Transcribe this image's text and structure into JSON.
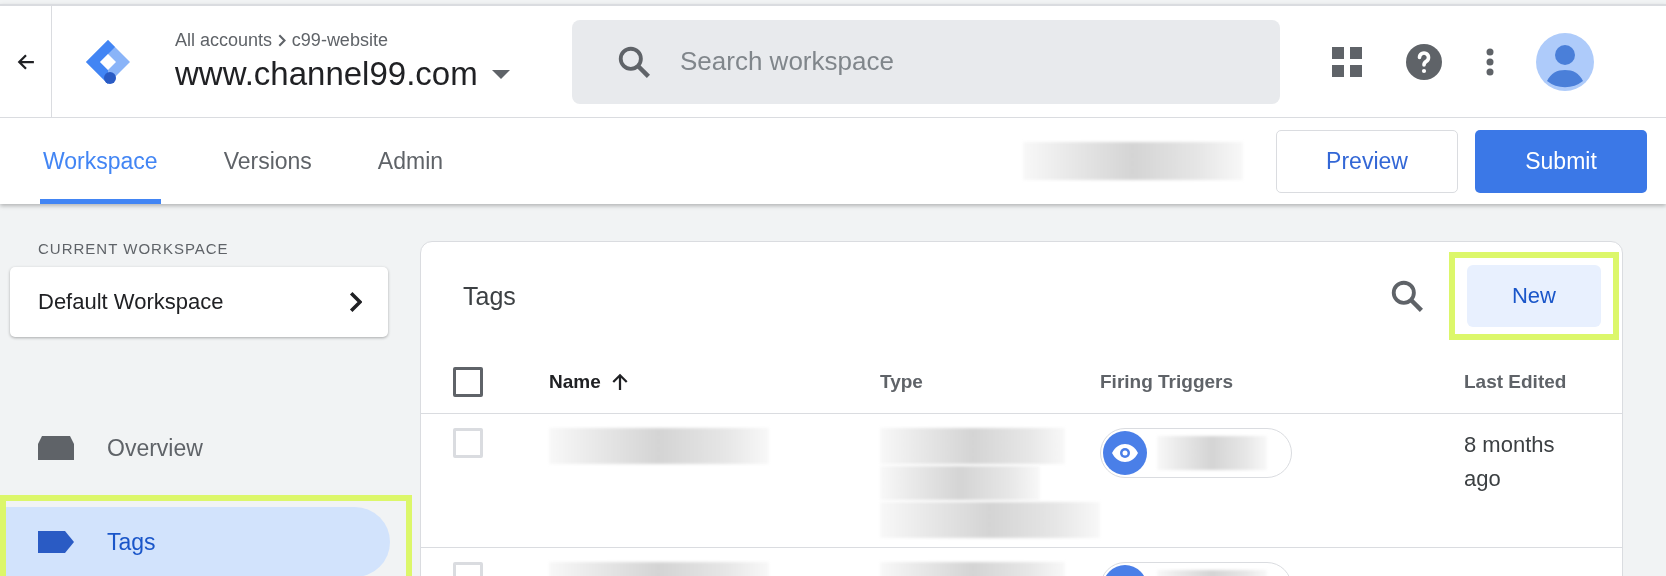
{
  "header": {
    "breadcrumb": [
      "All accounts",
      "c99-website"
    ],
    "container": "www.channel99.com",
    "search": {
      "placeholder": "Search workspace"
    }
  },
  "tabs": [
    {
      "label": "Workspace",
      "selected": true
    },
    {
      "label": "Versions",
      "selected": false
    },
    {
      "label": "Admin",
      "selected": false
    }
  ],
  "actions": {
    "preview": "Preview",
    "submit": "Submit"
  },
  "sidebar": {
    "section_label": "CURRENT WORKSPACE",
    "workspace": "Default Workspace",
    "items": [
      {
        "label": "Overview",
        "kind": "overview",
        "selected": false,
        "highlighted": false
      },
      {
        "label": "Tags",
        "kind": "tags",
        "selected": true,
        "highlighted": true
      }
    ]
  },
  "panel": {
    "title": "Tags",
    "new_button": {
      "label": "New",
      "highlighted": true
    },
    "select_all": {
      "checked": false
    },
    "columns": [
      {
        "label": "Name",
        "sorted": true
      },
      {
        "label": "Type",
        "sorted": false
      },
      {
        "label": "Firing Triggers",
        "sorted": false
      },
      {
        "label": "Last Edited",
        "sorted": false
      }
    ],
    "rows": [
      {
        "checked": false,
        "last_edited": [
          "8 months",
          "ago"
        ]
      },
      {
        "checked": false
      }
    ]
  }
}
